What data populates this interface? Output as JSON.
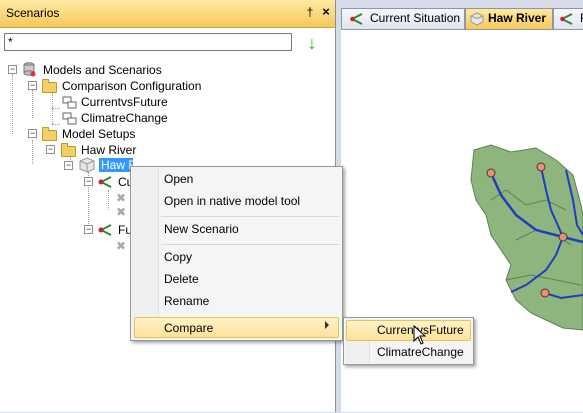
{
  "panel": {
    "title": "Scenarios",
    "pin_glyph": "†",
    "close_glyph": "×"
  },
  "search": {
    "value": "*"
  },
  "tree": {
    "root": "Models and Scenarios",
    "comparison_folder": "Comparison Configuration",
    "comparison_items": [
      "CurrentvsFuture",
      "ClimatreChange"
    ],
    "setups_folder": "Model Setups",
    "haw_folder": "Haw River",
    "selected_model": "Haw River",
    "child_1": "Cu",
    "child_2": "Fu"
  },
  "tabs": [
    {
      "label": "Current Situation",
      "active": false
    },
    {
      "label": "Haw River",
      "active": true
    },
    {
      "label": "F",
      "active": false
    }
  ],
  "context_menu": {
    "open": "Open",
    "open_native": "Open in native model tool",
    "new_scenario": "New Scenario",
    "copy": "Copy",
    "delete": "Delete",
    "rename": "Rename",
    "compare": "Compare"
  },
  "submenu": {
    "items": [
      "CurrentvsFuture",
      "ClimatreChange"
    ],
    "highlighted": "CurrentvsFuture"
  },
  "colors": {
    "accent": "#f5c95a",
    "map_fill": "#8fb57f",
    "river": "#1f3fbf",
    "node": "#e8907a"
  }
}
